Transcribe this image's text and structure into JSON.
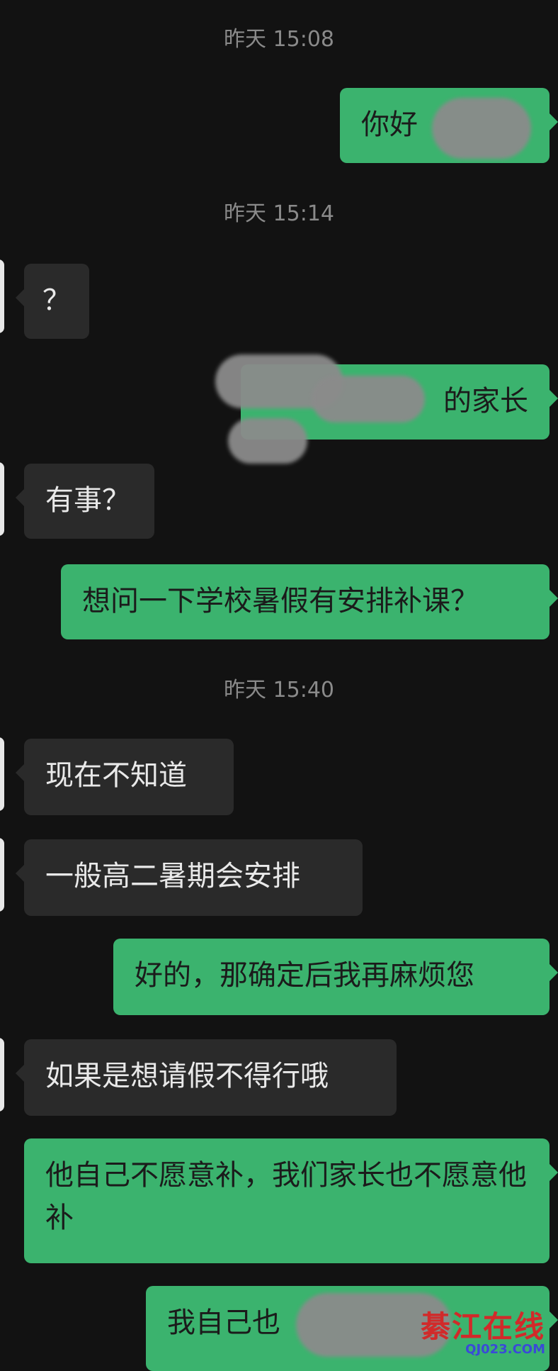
{
  "timestamps": [
    "昨天 15:08",
    "昨天 15:14",
    "昨天 15:40"
  ],
  "messages": [
    {
      "dir": "out",
      "text": "你好"
    },
    {
      "dir": "in",
      "text": "？"
    },
    {
      "dir": "out",
      "text": "的家长"
    },
    {
      "dir": "in",
      "text": "有事？"
    },
    {
      "dir": "out",
      "text": "想问一下学校暑假有安排补课？"
    },
    {
      "dir": "in",
      "text": "现在不知道"
    },
    {
      "dir": "in",
      "text": "一般高二暑期会安排"
    },
    {
      "dir": "out",
      "text": "好的，那确定后我再麻烦您"
    },
    {
      "dir": "in",
      "text": "如果是想请假不得行哦"
    },
    {
      "dir": "out",
      "text": "他自己不愿意补，我们家长也不愿意他补"
    },
    {
      "dir": "out",
      "text": "我自己也"
    }
  ],
  "watermark": {
    "title": "綦江在线",
    "sub": "QJ023.COM"
  }
}
